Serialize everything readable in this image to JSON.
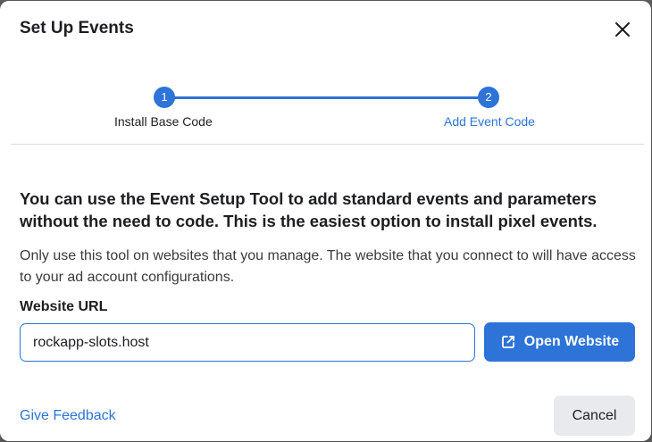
{
  "dialog": {
    "title": "Set Up Events"
  },
  "stepper": {
    "steps": [
      {
        "number": "1",
        "label": "Install Base Code"
      },
      {
        "number": "2",
        "label": "Add Event Code"
      }
    ],
    "active_color": "#2d73d8"
  },
  "content": {
    "headline": "You can use the Event Setup Tool to add standard events and parameters without the need to code. This is the easiest option to install pixel events.",
    "description": "Only use this tool on websites that you manage. The website that you connect to will have access to your ad account configurations.",
    "url_label": "Website URL",
    "url_value": "rockapp-slots.host",
    "open_button_label": "Open Website",
    "open_button_icon": "external-link-icon"
  },
  "footer": {
    "feedback_label": "Give Feedback",
    "cancel_label": "Cancel"
  },
  "colors": {
    "primary": "#2d73d8",
    "secondary_button": "#e9eaed"
  }
}
